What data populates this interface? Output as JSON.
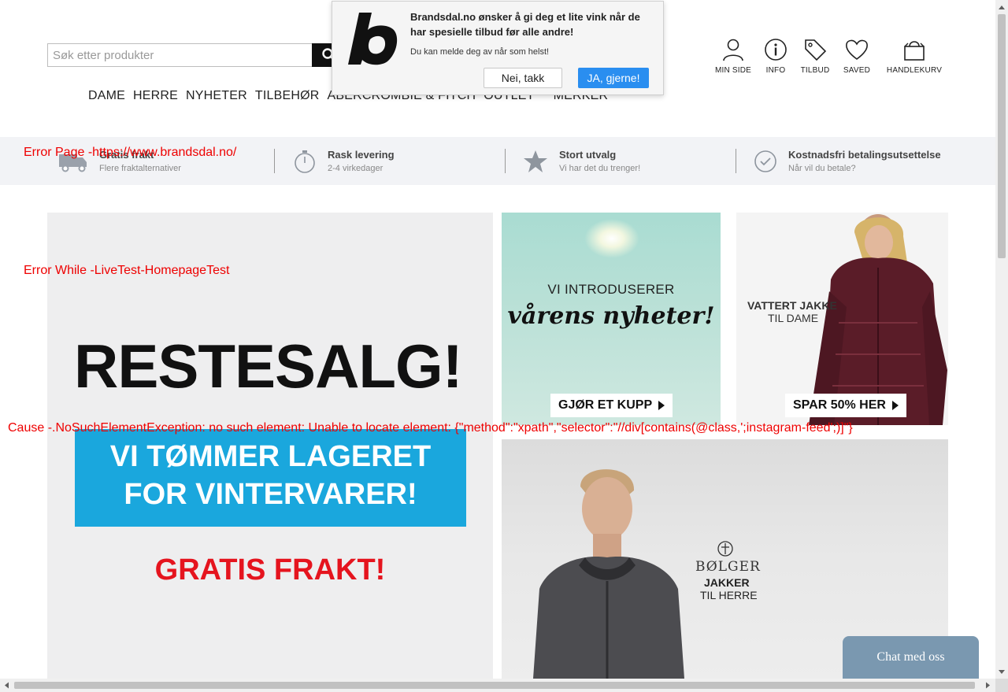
{
  "search": {
    "placeholder": "Søk etter produkter"
  },
  "nav": {
    "items": [
      "DAME",
      "HERRE",
      "NYHETER",
      "TILBEHØR",
      "ABERCROMBIE & FITCH",
      "OUTLET",
      "MERKER"
    ]
  },
  "header_icons": [
    {
      "label": "MIN SIDE",
      "icon": "user-icon"
    },
    {
      "label": "INFO",
      "icon": "info-icon"
    },
    {
      "label": "TILBUD",
      "icon": "tag-icon"
    },
    {
      "label": "SAVED",
      "icon": "heart-icon"
    },
    {
      "label": "HANDLEKURV",
      "icon": "shopping-bag-icon"
    }
  ],
  "benefits": [
    {
      "title": "Gratis frakt",
      "sub": "Flere fraktalternativer",
      "icon": "truck-icon"
    },
    {
      "title": "Rask levering",
      "sub": "2-4 virkedager",
      "icon": "stopwatch-icon"
    },
    {
      "title": "Stort utvalg",
      "sub": "Vi har det du trenger!",
      "icon": "star-icon"
    },
    {
      "title": "Kostnadsfri betalingsutsettelse",
      "sub": "Når vil du betale?",
      "icon": "check-circle-icon"
    }
  ],
  "promos": {
    "main": {
      "headline": "RESTESALG!",
      "blue_line1": "VI TØMMER LAGERET",
      "blue_line2": "FOR VINTERVARER!",
      "footer": "GRATIS FRAKT!"
    },
    "nyheter": {
      "intro": "VI INTRODUSERER",
      "script": "vårens nyheter!",
      "cta": "GJØR ET KUPP"
    },
    "jakke": {
      "title": "VATTERT JAKKE",
      "sub": "TIL DAME",
      "cta": "SPAR 50% HER"
    },
    "bolger": {
      "brand": "BØLGER",
      "line1": "JAKKER",
      "line2": "TIL HERRE"
    }
  },
  "errors": {
    "page": "Error Page -https://www.brandsdal.no/",
    "while": "Error While -LiveTest-HomepageTest",
    "cause": "Cause -.NoSuchElementException: no such element: Unable to locate element: {\"method\":\"xpath\",\"selector\":\"//div[contains(@class,';instagram-feed';)]\"}"
  },
  "popup": {
    "title": "Brandsdal.no ønsker å gi deg et lite vink når de har spesielle tilbud før alle andre!",
    "sub": "Du kan melde deg av når som helst!",
    "no_label": "Nei, takk",
    "yes_label": "JA, gjerne!"
  },
  "chat": {
    "label": "Chat med oss"
  },
  "colors": {
    "accent_blue": "#1aa7dd",
    "sale_red": "#e5141e",
    "popup_yes": "#2a8ef0",
    "chat_bg": "#7a98b0",
    "error_red": "#e00000"
  }
}
